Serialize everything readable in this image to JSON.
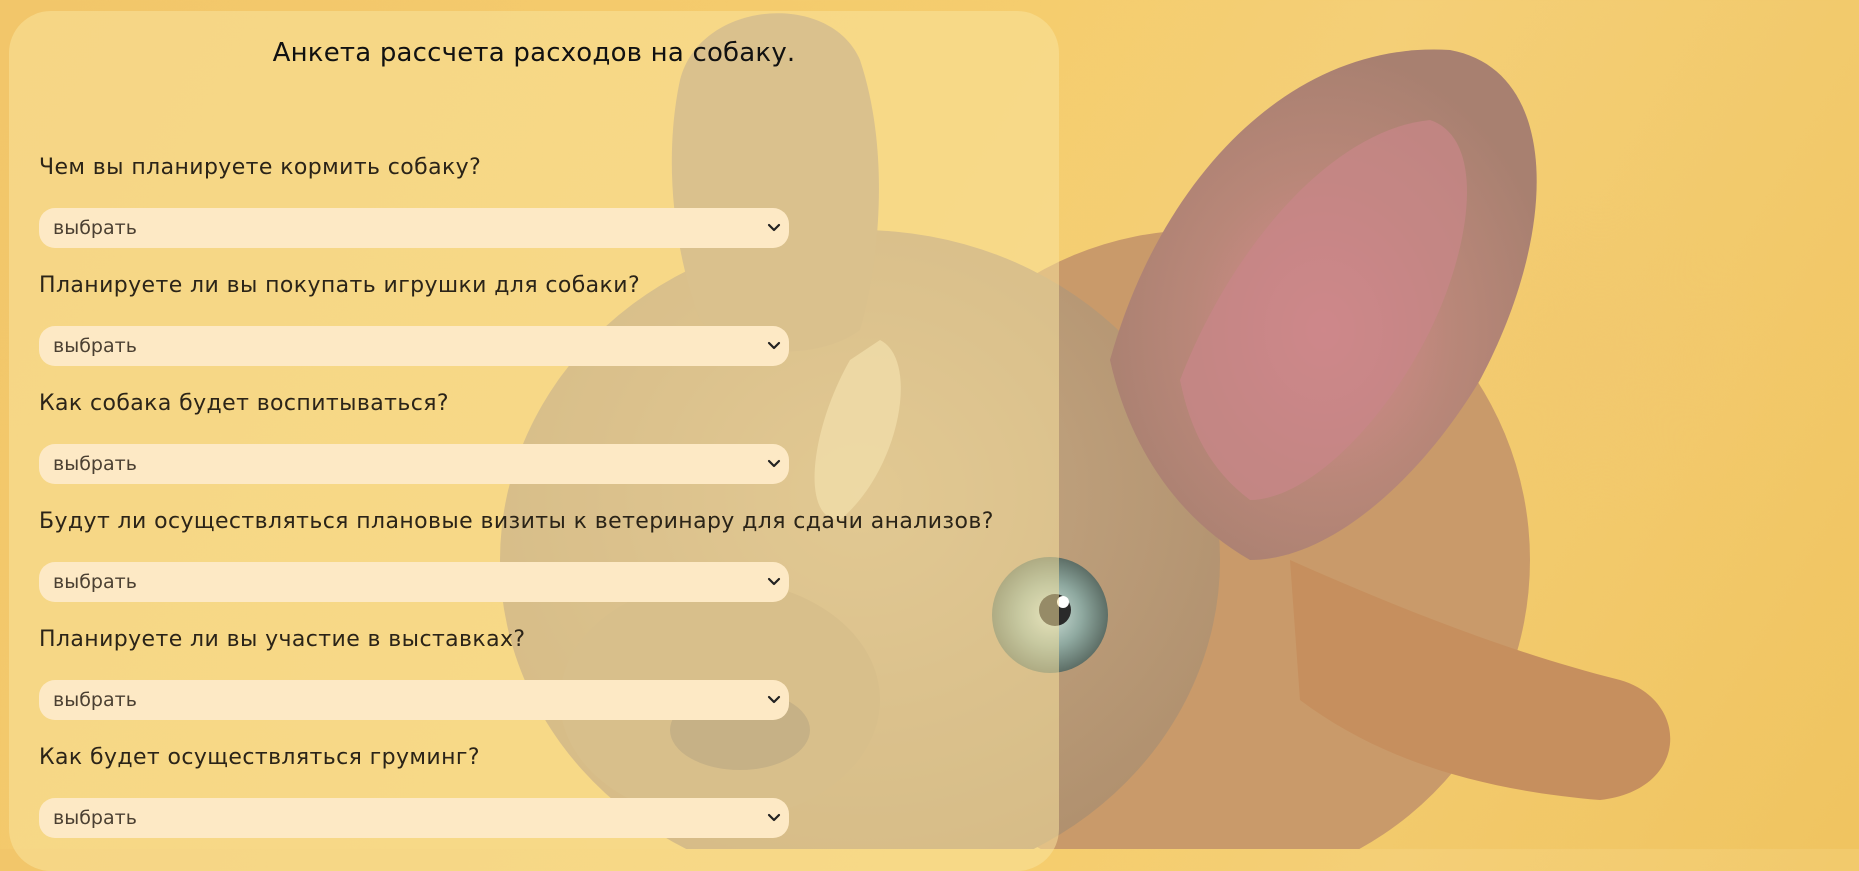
{
  "title": "Анкета рассчета расходов на собаку.",
  "questions": [
    {
      "label": "Чем вы планируете кормить собаку?",
      "value": "выбрать"
    },
    {
      "label": "Планируете ли вы покупать игрушки для собаки?",
      "value": "выбрать"
    },
    {
      "label": "Как собака будет воспитываться?",
      "value": "выбрать"
    },
    {
      "label": "Будут ли осуществляться плановые визиты к ветеринару для сдачи анализов?",
      "value": "выбрать"
    },
    {
      "label": "Планируете ли вы участие в выставках?",
      "value": "выбрать"
    },
    {
      "label": "Как будет осуществляться груминг?",
      "value": "выбрать"
    }
  ],
  "icons": {
    "select": "chevron-down-icon",
    "background": "dog-photo"
  },
  "colors": {
    "background": "#f2c66a",
    "panel": "#fae4a0",
    "select_fill": "#fde9c5",
    "text": "#2b2418"
  }
}
